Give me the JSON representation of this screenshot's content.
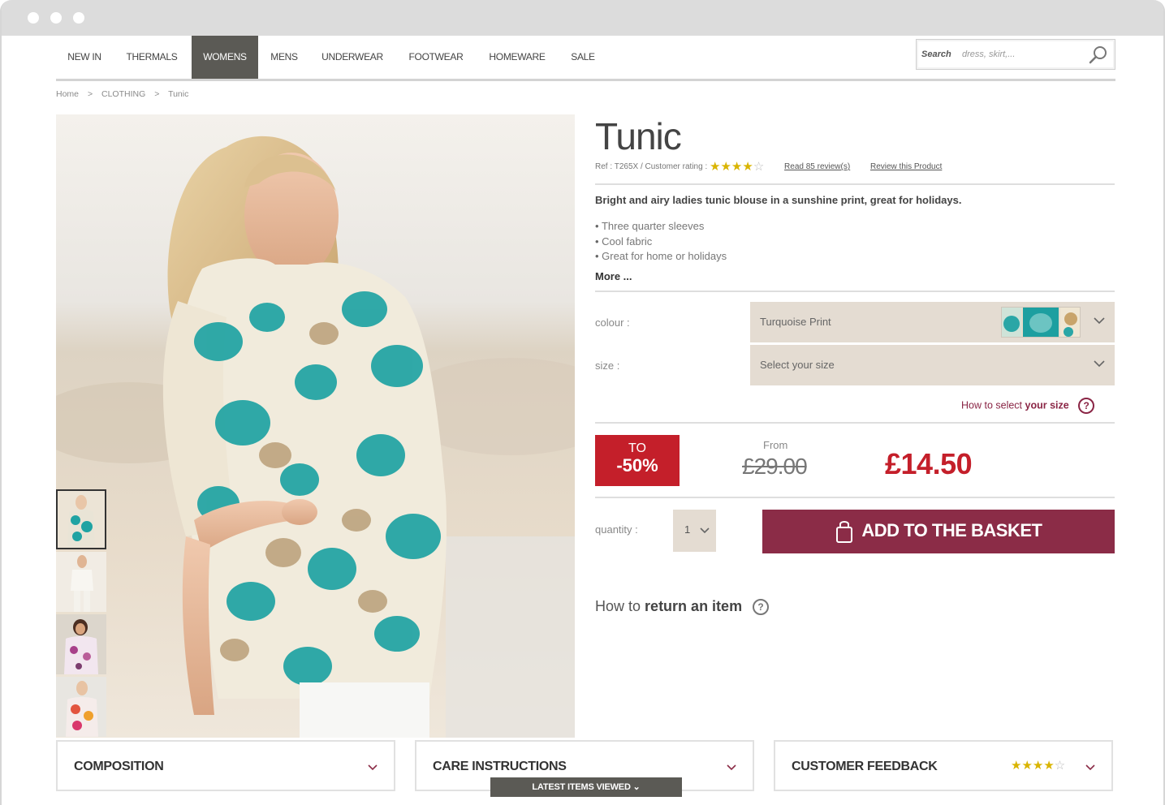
{
  "nav": {
    "items": [
      {
        "label": "NEW IN"
      },
      {
        "label": "THERMALS"
      },
      {
        "label": "WOMENS"
      },
      {
        "label": "MENS"
      },
      {
        "label": "UNDERWEAR"
      },
      {
        "label": "FOOTWEAR"
      },
      {
        "label": "HOMEWARE"
      },
      {
        "label": "SALE"
      }
    ],
    "active": "WOMENS"
  },
  "search": {
    "label": "Search",
    "placeholder": "dress, skirt,..."
  },
  "breadcrumb": [
    "Home",
    ">",
    "CLOTHING",
    ">",
    "Tunic"
  ],
  "product": {
    "title": "Tunic",
    "ref": "Ref : T265X",
    "rating_label": "/ Customer rating :",
    "rating": 4,
    "read_reviews": "Read 85 review(s)",
    "review_product": "Review this Product",
    "lead": "Bright and airy ladies tunic blouse in a sunshine print, great for holidays.",
    "bullets": [
      "Three quarter sleeves",
      "Cool fabric",
      "Great for home or holidays"
    ],
    "more": "More ..."
  },
  "options": {
    "colour_label": "colour :",
    "colour_value": "Turquoise Print",
    "size_label": "size :",
    "size_value": "Select your size",
    "size_help_prefix": "How to select",
    "size_help_bold": "your size"
  },
  "pricing": {
    "promo_to": "TO",
    "promo_pct": "-50%",
    "from_label": "From",
    "old_price": "£29.00",
    "new_price": "£14.50"
  },
  "purchase": {
    "quantity_label": "quantity :",
    "quantity_value": "1",
    "add_button": "ADD TO THE BASKET"
  },
  "returns": {
    "prefix": "How to",
    "bold": "return an item"
  },
  "panels": {
    "composition": "COMPOSITION",
    "care": "CARE INSTRUCTIONS",
    "feedback": "CUSTOMER FEEDBACK",
    "feedback_rating": 4,
    "latest": "LATEST ITEMS VIEWED"
  },
  "colors": {
    "accent": "#8b2c47",
    "sale_red": "#c41f2a",
    "nav_active": "#5b5a55",
    "select_bg": "#e4dcd2"
  }
}
